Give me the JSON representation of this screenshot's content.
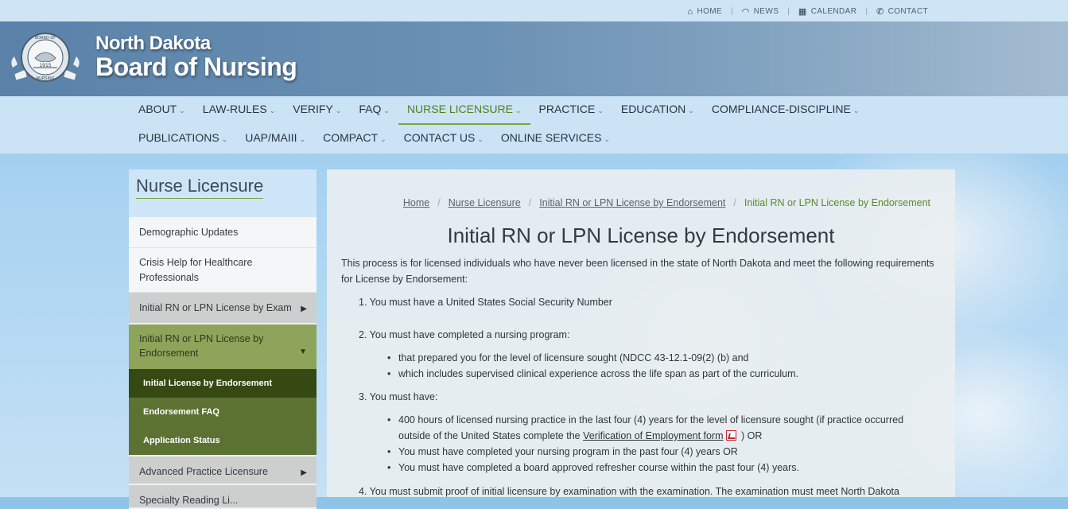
{
  "utility_nav": [
    {
      "icon": "home-icon",
      "glyph": "⌂",
      "label": "HOME"
    },
    {
      "icon": "rss-icon",
      "glyph": "◠",
      "label": "NEWS"
    },
    {
      "icon": "calendar-icon",
      "glyph": "▦",
      "label": "CALENDAR"
    },
    {
      "icon": "phone-icon",
      "glyph": "✆",
      "label": "CONTACT"
    }
  ],
  "brand": {
    "seal_top": "BOARD OF",
    "seal_year": "1915",
    "seal_bottom": "NURSING",
    "line1": "North Dakota",
    "line2": "Board of Nursing"
  },
  "main_nav": {
    "row1": [
      "ABOUT",
      "LAW-RULES",
      "VERIFY",
      "FAQ",
      "NURSE LICENSURE",
      "PRACTICE",
      "EDUCATION",
      "COMPLIANCE-DISCIPLINE"
    ],
    "row2": [
      "PUBLICATIONS",
      "UAP/MAIII",
      "COMPACT",
      "CONTACT US",
      "ONLINE SERVICES"
    ],
    "active": "NURSE LICENSURE",
    "caret": "⌄"
  },
  "sidebar": {
    "title": "Nurse Licensure",
    "links": [
      "Demographic Updates",
      "Crisis Help for Healthcare Professionals"
    ],
    "exam": "Initial RN or LPN License by Exam",
    "endorsement": "Initial RN or LPN License by Endorsement",
    "sub_items": [
      "Initial License by Endorsement",
      "Endorsement FAQ",
      "Application Status"
    ],
    "advanced": "Advanced Practice Licensure",
    "specialty": "Specialty Reading Li...",
    "arrow_right": "▶",
    "arrow_down": "▼"
  },
  "breadcrumb": {
    "items": [
      "Home",
      "Nurse Licensure",
      "Initial RN or LPN License by Endorsement"
    ],
    "current": "Initial RN or LPN License by Endorsement",
    "separator": "/"
  },
  "content": {
    "title": "Initial RN or LPN License by Endorsement",
    "intro": "This process is for licensed individuals who have never been licensed in the state of North Dakota and meet the following requirements for License by Endorsement:",
    "req1": "1. You must have a United States Social Security Number",
    "req2": "2. You must have completed a nursing program:",
    "req2_b1": "that prepared you for the level of licensure sought (NDCC 43-12.1-09(2) (b) and",
    "req2_b2": "which includes supervised clinical experience across the life span as part of the curriculum.",
    "req3": "3. You must have:",
    "req3_b1_text": " 400 hours of licensed nursing practice in the last four (4) years for the level of licensure sought (if practice occurred outside of the United States complete the ",
    "req3_b1_link": "Verification of Employment form",
    "req3_b1_end": " ) OR",
    "req3_b2": "You must have completed your nursing program in the past four (4) years OR",
    "req3_b3": "You must have completed a board approved refresher course within the past four (4) years.",
    "req4": "4. You must submit proof of initial licensure by examination with the examination.  The examination must meet North Dakota"
  },
  "colors": {
    "accent_green": "#78a541",
    "olive": "#8ea45a",
    "dark_green": "#364913",
    "banner_blue": "#5a82a8"
  }
}
